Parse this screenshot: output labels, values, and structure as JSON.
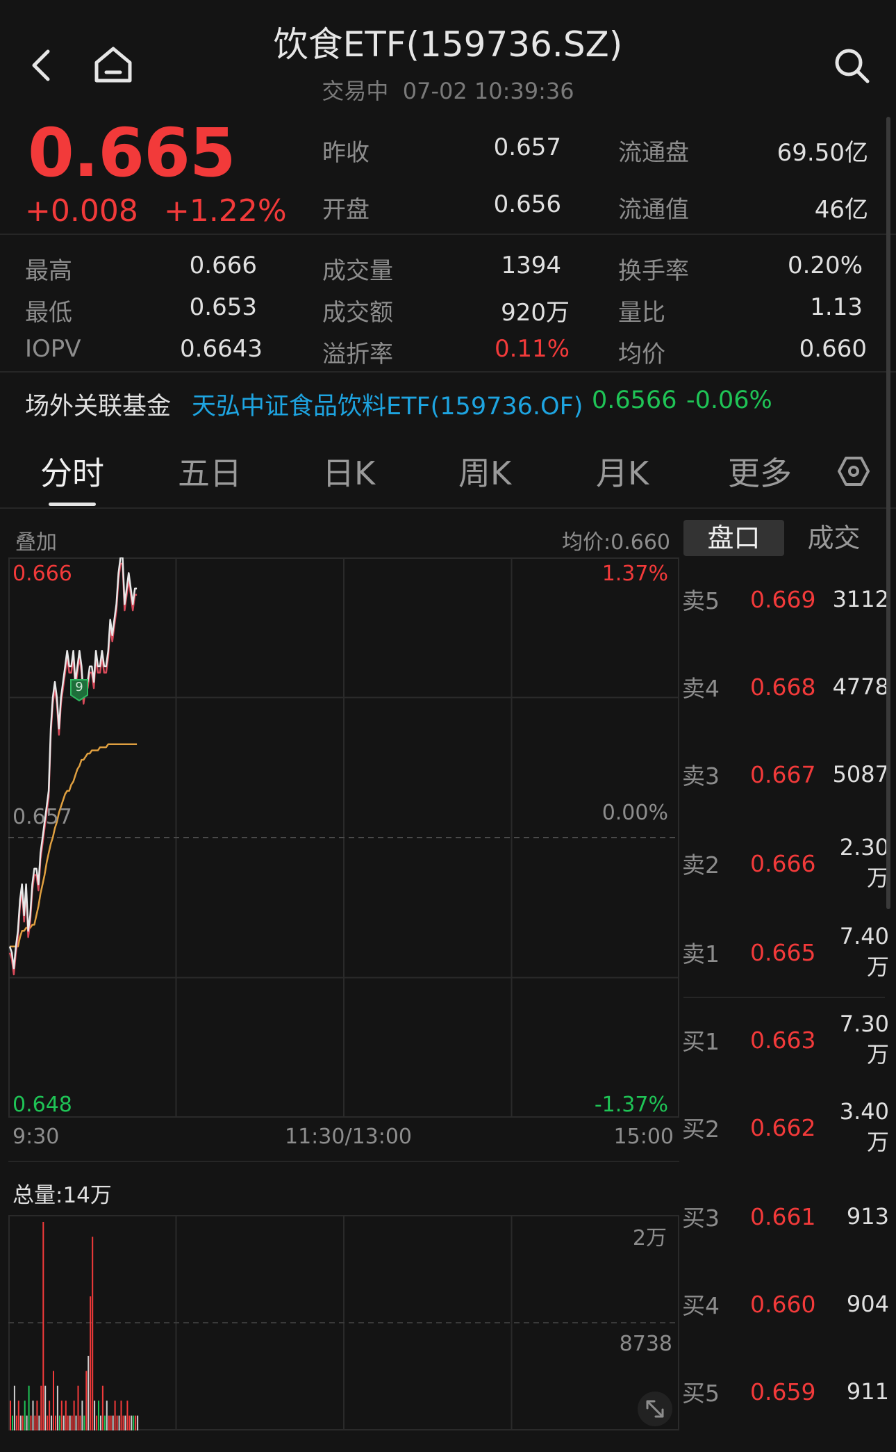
{
  "header": {
    "title": "饮食ETF(159736.SZ)",
    "status": "交易中",
    "datetime": "07-02 10:39:36"
  },
  "quote": {
    "price": "0.665",
    "change": "+0.008",
    "change_pct": "+1.22%",
    "fields": [
      {
        "label": "昨收",
        "value": "0.657"
      },
      {
        "label": "开盘",
        "value": "0.656"
      },
      {
        "label": "流通盘",
        "value": "69.50亿"
      },
      {
        "label": "流通值",
        "value": "46亿"
      },
      {
        "label": "最高",
        "value": "0.666"
      },
      {
        "label": "最低",
        "value": "0.653"
      },
      {
        "label": "IOPV",
        "value": "0.6643"
      },
      {
        "label": "成交量",
        "value": "1394"
      },
      {
        "label": "成交额",
        "value": "920万"
      },
      {
        "label": "溢折率",
        "value": "0.11%"
      },
      {
        "label": "换手率",
        "value": "0.20%"
      },
      {
        "label": "量比",
        "value": "1.13"
      },
      {
        "label": "均价",
        "value": "0.660"
      }
    ]
  },
  "linked_fund": {
    "label": "场外关联基金",
    "name": "天弘中证食品饮料ETF(159736.OF)",
    "nav": "0.6566",
    "change": "-0.06%"
  },
  "tabs": [
    "分时",
    "五日",
    "日K",
    "周K",
    "月K",
    "更多"
  ],
  "active_tab": 0,
  "chart": {
    "overlay_label": "叠加",
    "avg_price_label": "均价:0.660",
    "y_top": "0.666",
    "y_mid": "0.657",
    "y_bottom": "0.648",
    "pct_top": "1.37%",
    "pct_mid": "0.00%",
    "pct_bottom": "-1.37%",
    "time_start": "9:30",
    "time_mid": "11:30/13:00",
    "time_end": "15:00",
    "marker": "9",
    "volume_label": "总量:14万",
    "vol_top": "2万",
    "vol_mid": "8738"
  },
  "chart_data": {
    "type": "line",
    "y_range": [
      0.648,
      0.666
    ],
    "series": [
      {
        "values": [
          0.6535,
          0.6533,
          0.6528,
          0.6535,
          0.654,
          0.655,
          0.6555,
          0.6545,
          0.6555,
          0.654,
          0.6545,
          0.6555,
          0.656,
          0.656,
          0.6555,
          0.6565,
          0.657,
          0.6575,
          0.658,
          0.6585,
          0.6605,
          0.6615,
          0.662,
          0.6615,
          0.6605,
          0.6615,
          0.662,
          0.6625,
          0.663,
          0.6625,
          0.6625,
          0.663,
          0.662,
          0.6625,
          0.663,
          0.6625,
          0.6615,
          0.662,
          0.662,
          0.6625,
          0.6625,
          0.662,
          0.663,
          0.6625,
          0.6625,
          0.663,
          0.6625,
          0.6625,
          0.663,
          0.664,
          0.6635,
          0.664,
          0.6645,
          0.6655,
          0.666,
          0.666,
          0.6645,
          0.665,
          0.6655,
          0.665,
          0.6645,
          0.665,
          0.665
        ]
      },
      {
        "values": [
          0.6535,
          0.6535,
          0.6535,
          0.6535,
          0.6535,
          0.6538,
          0.654,
          0.654,
          0.6541,
          0.6541,
          0.6541,
          0.6542,
          0.6542,
          0.6545,
          0.6548,
          0.6552,
          0.6555,
          0.6558,
          0.6562,
          0.6565,
          0.6568,
          0.657,
          0.6573,
          0.6575,
          0.6578,
          0.658,
          0.6582,
          0.6584,
          0.6585,
          0.6585,
          0.6587,
          0.6588,
          0.659,
          0.6592,
          0.6593,
          0.6595,
          0.6595,
          0.6596,
          0.6597,
          0.6597,
          0.6598,
          0.6598,
          0.6598,
          0.6598,
          0.6599,
          0.6599,
          0.6599,
          0.6599,
          0.66,
          0.66,
          0.66,
          0.66,
          0.66,
          0.66,
          0.66,
          0.66,
          0.66,
          0.66,
          0.66,
          0.66,
          0.66,
          0.66,
          0.66
        ]
      }
    ],
    "volume": [
      2,
      1,
      3,
      1,
      2,
      1,
      1,
      2,
      1,
      3,
      1,
      2,
      1,
      2,
      1,
      3,
      14,
      3,
      1,
      2,
      1,
      4,
      1,
      3,
      1,
      2,
      1,
      2,
      1,
      1,
      1,
      2,
      1,
      3,
      1,
      2,
      1,
      4,
      5,
      9,
      13,
      2,
      1,
      2,
      1,
      3,
      1,
      2,
      1,
      1,
      1,
      2,
      1,
      1,
      2,
      1,
      1,
      2,
      1,
      1,
      1,
      1,
      1
    ]
  },
  "orderbook": {
    "tabs": [
      "盘口",
      "成交"
    ],
    "asks": [
      {
        "label": "卖5",
        "price": "0.669",
        "vol": "3112"
      },
      {
        "label": "卖4",
        "price": "0.668",
        "vol": "4778"
      },
      {
        "label": "卖3",
        "price": "0.667",
        "vol": "5087"
      },
      {
        "label": "卖2",
        "price": "0.666",
        "vol": "2.30万"
      },
      {
        "label": "卖1",
        "price": "0.665",
        "vol": "7.40万"
      }
    ],
    "bids": [
      {
        "label": "买1",
        "price": "0.663",
        "vol": "7.30万"
      },
      {
        "label": "买2",
        "price": "0.662",
        "vol": "3.40万"
      },
      {
        "label": "买3",
        "price": "0.661",
        "vol": "913"
      },
      {
        "label": "买4",
        "price": "0.660",
        "vol": "904"
      },
      {
        "label": "买5",
        "price": "0.659",
        "vol": "911"
      }
    ]
  },
  "colors": {
    "up": "#f23a3a",
    "down": "#1fc456",
    "avg_line": "#e0a040",
    "price_line": "#e8e8e8"
  }
}
